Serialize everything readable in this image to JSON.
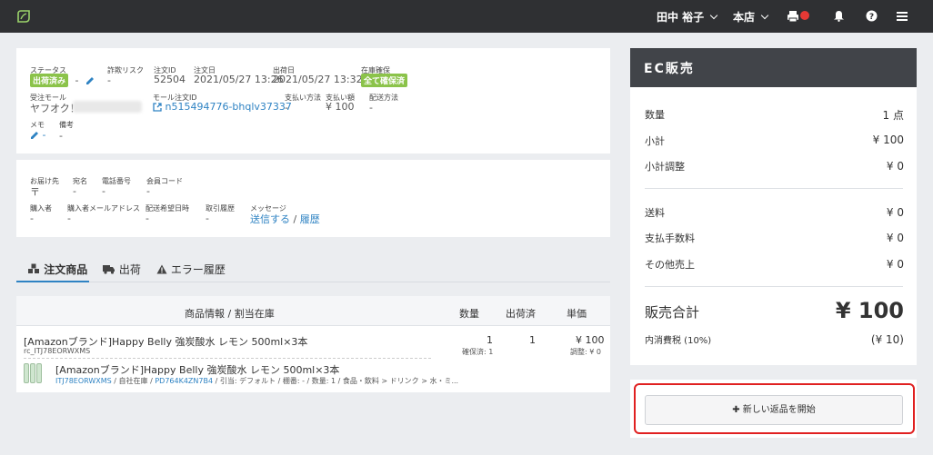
{
  "topbar": {
    "user_name": "田中 裕子",
    "store": "本店",
    "colors": {
      "background": "#2f3033",
      "notification_dot": "#e53935"
    }
  },
  "order": {
    "status_label": "ステータス",
    "status_badge": "出荷済み",
    "status_dash": "-",
    "fraud_risk_label": "詐欺リスク",
    "fraud_risk_value": "-",
    "order_id_label": "注文ID",
    "order_id_value": "52504",
    "order_date_label": "注文日",
    "order_date_value": "2021/05/27 13:26",
    "ship_date_label": "出荷日",
    "ship_date_value": "2021/05/27 13:32",
    "stock_label": "在庫確保",
    "stock_badge": "全て確保済",
    "mall_label": "受注モール",
    "mall_value": "ヤフオク！",
    "mall_order_id_label": "モール注文ID",
    "mall_order_id_value": "n515494776-bhqlv37337",
    "payment_method_label": "支払い方法",
    "payment_method_value": "-",
    "payment_amount_label": "支払い額",
    "payment_amount_value": "¥ 100",
    "delivery_method_label": "配送方法",
    "delivery_method_value": "-",
    "memo_label": "メモ",
    "memo_value": "-",
    "remarks_label": "備考",
    "remarks_value": "-"
  },
  "shipping": {
    "dest_label": "お届け先",
    "dest_value": "〒",
    "name_label": "宛名",
    "name_value": "-",
    "phone_label": "電話番号",
    "phone_value": "-",
    "member_label": "会員コード",
    "member_value": "-",
    "buyer_label": "購入者",
    "buyer_value": "-",
    "buyer_email_label": "購入者メールアドレス",
    "buyer_email_value": "-",
    "delivery_date_label": "配送希望日時",
    "delivery_date_value": "-",
    "history_label": "取引履歴",
    "history_value": "-",
    "message_label": "メッセージ",
    "message_send": "送信する",
    "message_sep": "/",
    "message_history": "履歴"
  },
  "tabs": [
    {
      "label": "注文商品",
      "icon": "cubes-icon"
    },
    {
      "label": "出荷",
      "icon": "truck-icon"
    },
    {
      "label": "エラー履歴",
      "icon": "warning-icon"
    }
  ],
  "table": {
    "headers": [
      "商品情報 / 割当在庫",
      "数量",
      "出荷済",
      "単価"
    ],
    "item": {
      "name": "[Amazonブランド]Happy Belly 強炭酸水 レモン 500ml×3本",
      "sku": "rc_ITJ78EORWXMS",
      "qty": "1",
      "qty_sub": "確保済: 1",
      "shipped": "1",
      "price": "¥ 100",
      "price_sub": "調整: ¥ 0"
    },
    "stock": {
      "name": "[Amazonブランド]Happy Belly 強炭酸水 レモン 500ml×3本",
      "code": "ITJ78EORWXMS",
      "location": "/ 自社在庫 /",
      "code2": "PD764K4ZN7B4",
      "details": "/ 引当: デフォルト / 棚番: - / 数量: 1 / 食品・飲料 > ドリンク > 水・ミ..."
    }
  },
  "ec": {
    "title": "EC販売",
    "quantity_label": "数量",
    "quantity_value": "1 点",
    "subtotal_label": "小計",
    "subtotal_value": "¥ 100",
    "subtotal_adj_label": "小計調整",
    "subtotal_adj_value": "¥ 0",
    "shipping_label": "送料",
    "shipping_value": "¥ 0",
    "fee_label": "支払手数料",
    "fee_value": "¥ 0",
    "other_label": "その他売上",
    "other_value": "¥ 0",
    "total_label": "販売合計",
    "total_value": "¥ 100",
    "tax_label": "内消費税 (10%)",
    "tax_value": "(¥ 10)"
  },
  "return_button": "新しい返品を開始"
}
